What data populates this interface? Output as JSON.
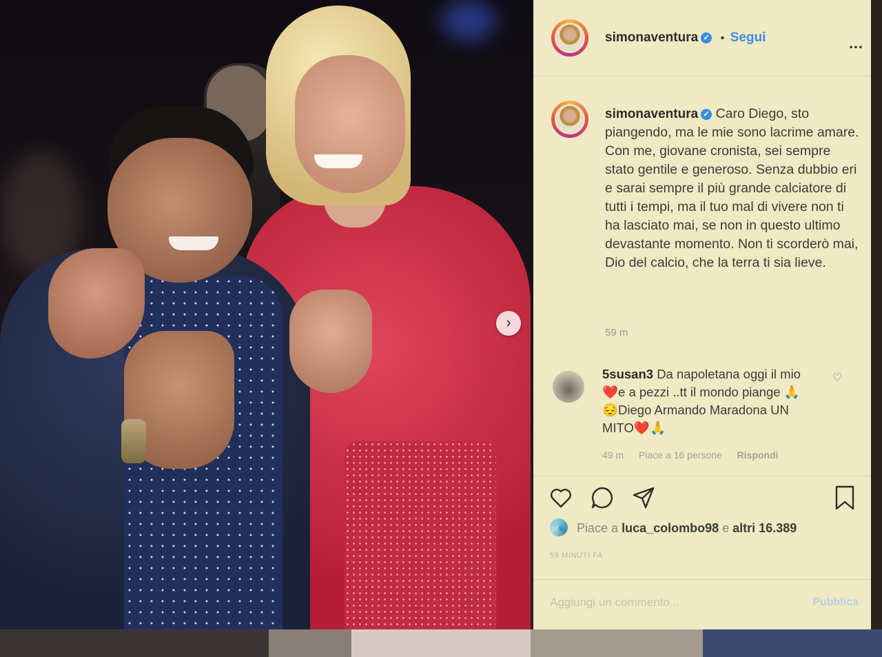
{
  "post": {
    "username": "simonaventura",
    "verified_mark": "✓",
    "follow_separator": "•",
    "follow_label": "Segui",
    "more_icon": "…",
    "next_icon": "›"
  },
  "caption": {
    "username": "simonaventura",
    "text": "Caro Diego, sto piangendo, ma le mie sono lacrime amare. Con me, giovane cronista, sei sempre stato gentile e generoso. Senza dubbio eri e sarai sempre il più grande calciatore di tutti i tempi, ma il tuo mal di vivere non ti ha lasciato mai, se non in questo ultimo devastante momento. Non ti scorderò mai, Dio del calcio, che la terra ti sia lieve.",
    "time": "59 m"
  },
  "comment": {
    "username": "5susan3",
    "text": "Da napoletana oggi il mio ❤️e a pezzi ..tt il mondo piange 🙏😔Diego Armando Maradona UN MITO❤️🙏",
    "time": "49 m",
    "likes": "Piace a 16 persone",
    "reply": "Rispondi",
    "heart_icon": "♡"
  },
  "actions": {
    "icons": [
      "heart-icon",
      "comment-icon",
      "share-icon",
      "bookmark-icon"
    ]
  },
  "likes": {
    "prefix": "Piace a",
    "user": "luca_colombo98",
    "connector": "e",
    "others": "altri 16.389"
  },
  "timestamp": "59 MINUTI FA",
  "add_comment": {
    "placeholder": "Aggiungi un commento...",
    "publish": "Pubblica"
  },
  "colors": {
    "panel_bg": "#efe9c4",
    "accent_blue": "#3b8de0",
    "dress_red": "#c02a42"
  }
}
